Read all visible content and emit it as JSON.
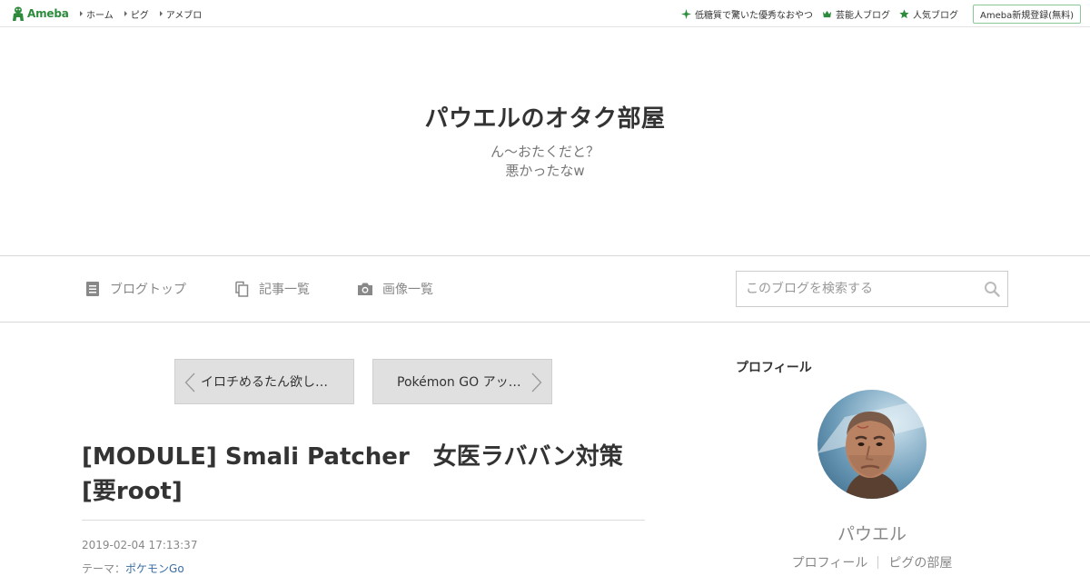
{
  "topbar": {
    "logo_text": "Ameba",
    "nav": [
      "ホーム",
      "ピグ",
      "アメブロ"
    ],
    "right_links": [
      {
        "icon": "sparkle-icon",
        "label": "低糖質で驚いた優秀なおやつ"
      },
      {
        "icon": "crown-icon",
        "label": "芸能人ブログ"
      },
      {
        "icon": "star-icon",
        "label": "人気ブログ"
      }
    ],
    "signup_label": "Ameba新規登録(無料)",
    "accent_color": "#2d8c3c"
  },
  "header": {
    "title": "パウエルのオタク部屋",
    "description_line1": "ん～おたくだと？",
    "description_line2": "悪かったなw"
  },
  "nav": {
    "items": [
      {
        "icon": "document-icon",
        "label": "ブログトップ"
      },
      {
        "icon": "copy-icon",
        "label": "記事一覧"
      },
      {
        "icon": "camera-icon",
        "label": "画像一覧"
      }
    ],
    "search_placeholder": "このブログを検索する"
  },
  "pager": {
    "prev_label": "イロチめるたん欲しいの",
    "next_label": "Pokémon GO アップデート"
  },
  "entry": {
    "title": "[MODULE] Smali Patcher　女医ラババン対策　[要root]",
    "date": "2019-02-04 17:13:37",
    "theme_label": "テーマ：",
    "theme_value": "ポケモンGo"
  },
  "sidebar": {
    "heading": "プロフィール",
    "name": "パウエル",
    "links": [
      "プロフィール",
      "ピグの部屋"
    ]
  }
}
